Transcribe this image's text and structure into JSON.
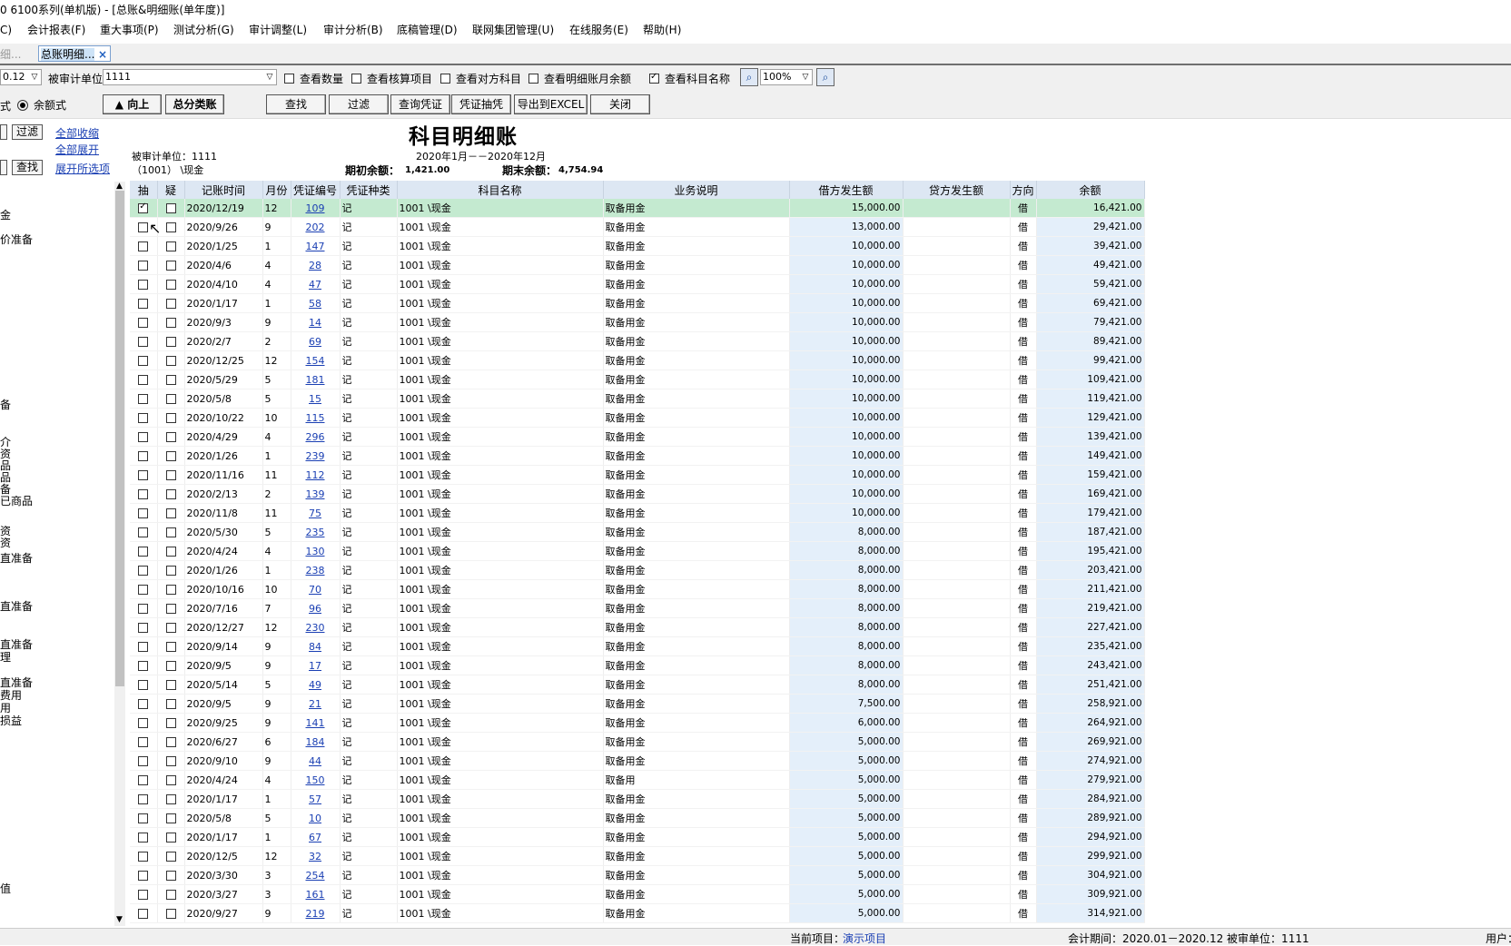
{
  "window": {
    "title": "0 6100系列(单机版) - [总账&明细账(单年度)]"
  },
  "menu": [
    "C)",
    "会计报表(F)",
    "重大事项(P)",
    "测试分析(G)",
    "审计调整(L)",
    "审计分析(B)",
    "底稿管理(D)",
    "联网集团管理(U)",
    "在线服务(E)",
    "帮助(H)"
  ],
  "tabs": {
    "prev_label": "细...",
    "active_label": "总账明细...",
    "close": "×"
  },
  "toolbar": {
    "period_value": "0.12",
    "unit_label": "被审计单位",
    "unit_value": "1111",
    "checkboxes": [
      {
        "label": "查看数量",
        "checked": false
      },
      {
        "label": "查看核算项目",
        "checked": false
      },
      {
        "label": "查看对方科目",
        "checked": false
      },
      {
        "label": "查看明细账月余额",
        "checked": false
      },
      {
        "label": "查看科目名称",
        "checked": true
      }
    ],
    "zoom": "100%",
    "mode_label_prefix": "式",
    "mode_radio_label": "余额式",
    "btn_up": "▲ 向上",
    "btn_general": "总分类账",
    "btn_find": "查找",
    "btn_filter": "过滤",
    "btn_query_voucher": "查询凭证",
    "btn_sample_voucher": "凭证抽凭",
    "btn_export": "导出到EXCEL",
    "btn_close": "关闭"
  },
  "left_panel": {
    "filter_btn": "过滤",
    "find_btn": "查找",
    "collapse_all": "全部收缩",
    "expand_all": "全部展开",
    "expand_options": "展开所选项",
    "tree_fragments": [
      "金",
      "价准备",
      "备",
      "介",
      "资",
      "品",
      "品",
      "备",
      "已商品",
      "资",
      "资",
      "直准备",
      "直准备",
      "直准备",
      "理",
      "直准备",
      "费用",
      "用",
      "损益",
      "值"
    ]
  },
  "report": {
    "title": "科目明细账",
    "period": "2020年1月－－2020年12月",
    "unit_line": "被审计单位：1111",
    "account_line": "（1001）  \\现金",
    "opening_label": "期初余额：",
    "opening_value": "1,421.00",
    "closing_label": "期末余额：",
    "closing_value": "4,754.94"
  },
  "grid": {
    "columns": [
      "抽",
      "疑",
      "记账时间",
      "月份",
      "凭证编号",
      "凭证种类",
      "科目名称",
      "业务说明",
      "借方发生额",
      "贷方发生额",
      "方向",
      "余额"
    ],
    "rows": [
      {
        "chou": true,
        "date": "2020/12/19",
        "month": "12",
        "no": "109",
        "type": "记",
        "account": "1001  \\现金",
        "desc": "取备用金",
        "debit": "15,000.00",
        "credit": "",
        "dir": "借",
        "balance": "16,421.00"
      },
      {
        "chou": false,
        "date": "2020/9/26",
        "month": "9",
        "no": "202",
        "type": "记",
        "account": "1001  \\现金",
        "desc": "取备用金",
        "debit": "13,000.00",
        "credit": "",
        "dir": "借",
        "balance": "29,421.00"
      },
      {
        "chou": false,
        "date": "2020/1/25",
        "month": "1",
        "no": "147",
        "type": "记",
        "account": "1001  \\现金",
        "desc": "取备用金",
        "debit": "10,000.00",
        "credit": "",
        "dir": "借",
        "balance": "39,421.00"
      },
      {
        "chou": false,
        "date": "2020/4/6",
        "month": "4",
        "no": "28",
        "type": "记",
        "account": "1001  \\现金",
        "desc": "取备用金",
        "debit": "10,000.00",
        "credit": "",
        "dir": "借",
        "balance": "49,421.00"
      },
      {
        "chou": false,
        "date": "2020/4/10",
        "month": "4",
        "no": "47",
        "type": "记",
        "account": "1001  \\现金",
        "desc": "取备用金",
        "debit": "10,000.00",
        "credit": "",
        "dir": "借",
        "balance": "59,421.00"
      },
      {
        "chou": false,
        "date": "2020/1/17",
        "month": "1",
        "no": "58",
        "type": "记",
        "account": "1001  \\现金",
        "desc": "取备用金",
        "debit": "10,000.00",
        "credit": "",
        "dir": "借",
        "balance": "69,421.00"
      },
      {
        "chou": false,
        "date": "2020/9/3",
        "month": "9",
        "no": "14",
        "type": "记",
        "account": "1001  \\现金",
        "desc": "取备用金",
        "debit": "10,000.00",
        "credit": "",
        "dir": "借",
        "balance": "79,421.00"
      },
      {
        "chou": false,
        "date": "2020/2/7",
        "month": "2",
        "no": "69",
        "type": "记",
        "account": "1001  \\现金",
        "desc": "取备用金",
        "debit": "10,000.00",
        "credit": "",
        "dir": "借",
        "balance": "89,421.00"
      },
      {
        "chou": false,
        "date": "2020/12/25",
        "month": "12",
        "no": "154",
        "type": "记",
        "account": "1001  \\现金",
        "desc": "取备用金",
        "debit": "10,000.00",
        "credit": "",
        "dir": "借",
        "balance": "99,421.00"
      },
      {
        "chou": false,
        "date": "2020/5/29",
        "month": "5",
        "no": "181",
        "type": "记",
        "account": "1001  \\现金",
        "desc": "取备用金",
        "debit": "10,000.00",
        "credit": "",
        "dir": "借",
        "balance": "109,421.00"
      },
      {
        "chou": false,
        "date": "2020/5/8",
        "month": "5",
        "no": "15",
        "type": "记",
        "account": "1001  \\现金",
        "desc": "取备用金",
        "debit": "10,000.00",
        "credit": "",
        "dir": "借",
        "balance": "119,421.00"
      },
      {
        "chou": false,
        "date": "2020/10/22",
        "month": "10",
        "no": "115",
        "type": "记",
        "account": "1001  \\现金",
        "desc": "取备用金",
        "debit": "10,000.00",
        "credit": "",
        "dir": "借",
        "balance": "129,421.00"
      },
      {
        "chou": false,
        "date": "2020/4/29",
        "month": "4",
        "no": "296",
        "type": "记",
        "account": "1001  \\现金",
        "desc": "取备用金",
        "debit": "10,000.00",
        "credit": "",
        "dir": "借",
        "balance": "139,421.00"
      },
      {
        "chou": false,
        "date": "2020/1/26",
        "month": "1",
        "no": "239",
        "type": "记",
        "account": "1001  \\现金",
        "desc": "取备用金",
        "debit": "10,000.00",
        "credit": "",
        "dir": "借",
        "balance": "149,421.00"
      },
      {
        "chou": false,
        "date": "2020/11/16",
        "month": "11",
        "no": "112",
        "type": "记",
        "account": "1001  \\现金",
        "desc": "取备用金",
        "debit": "10,000.00",
        "credit": "",
        "dir": "借",
        "balance": "159,421.00"
      },
      {
        "chou": false,
        "date": "2020/2/13",
        "month": "2",
        "no": "139",
        "type": "记",
        "account": "1001  \\现金",
        "desc": "取备用金",
        "debit": "10,000.00",
        "credit": "",
        "dir": "借",
        "balance": "169,421.00"
      },
      {
        "chou": false,
        "date": "2020/11/8",
        "month": "11",
        "no": "75",
        "type": "记",
        "account": "1001  \\现金",
        "desc": "取备用金",
        "debit": "10,000.00",
        "credit": "",
        "dir": "借",
        "balance": "179,421.00"
      },
      {
        "chou": false,
        "date": "2020/5/30",
        "month": "5",
        "no": "235",
        "type": "记",
        "account": "1001  \\现金",
        "desc": "取备用金",
        "debit": "8,000.00",
        "credit": "",
        "dir": "借",
        "balance": "187,421.00"
      },
      {
        "chou": false,
        "date": "2020/4/24",
        "month": "4",
        "no": "130",
        "type": "记",
        "account": "1001  \\现金",
        "desc": "取备用金",
        "debit": "8,000.00",
        "credit": "",
        "dir": "借",
        "balance": "195,421.00"
      },
      {
        "chou": false,
        "date": "2020/1/26",
        "month": "1",
        "no": "238",
        "type": "记",
        "account": "1001  \\现金",
        "desc": "取备用金",
        "debit": "8,000.00",
        "credit": "",
        "dir": "借",
        "balance": "203,421.00"
      },
      {
        "chou": false,
        "date": "2020/10/16",
        "month": "10",
        "no": "70",
        "type": "记",
        "account": "1001  \\现金",
        "desc": "取备用金",
        "debit": "8,000.00",
        "credit": "",
        "dir": "借",
        "balance": "211,421.00"
      },
      {
        "chou": false,
        "date": "2020/7/16",
        "month": "7",
        "no": "96",
        "type": "记",
        "account": "1001  \\现金",
        "desc": "取备用金",
        "debit": "8,000.00",
        "credit": "",
        "dir": "借",
        "balance": "219,421.00"
      },
      {
        "chou": false,
        "date": "2020/12/27",
        "month": "12",
        "no": "230",
        "type": "记",
        "account": "1001  \\现金",
        "desc": "取备用金",
        "debit": "8,000.00",
        "credit": "",
        "dir": "借",
        "balance": "227,421.00"
      },
      {
        "chou": false,
        "date": "2020/9/14",
        "month": "9",
        "no": "84",
        "type": "记",
        "account": "1001  \\现金",
        "desc": "取备用金",
        "debit": "8,000.00",
        "credit": "",
        "dir": "借",
        "balance": "235,421.00"
      },
      {
        "chou": false,
        "date": "2020/9/5",
        "month": "9",
        "no": "17",
        "type": "记",
        "account": "1001  \\现金",
        "desc": "取备用金",
        "debit": "8,000.00",
        "credit": "",
        "dir": "借",
        "balance": "243,421.00"
      },
      {
        "chou": false,
        "date": "2020/5/14",
        "month": "5",
        "no": "49",
        "type": "记",
        "account": "1001  \\现金",
        "desc": "取备用金",
        "debit": "8,000.00",
        "credit": "",
        "dir": "借",
        "balance": "251,421.00"
      },
      {
        "chou": false,
        "date": "2020/9/5",
        "month": "9",
        "no": "21",
        "type": "记",
        "account": "1001  \\现金",
        "desc": "取备用金",
        "debit": "7,500.00",
        "credit": "",
        "dir": "借",
        "balance": "258,921.00"
      },
      {
        "chou": false,
        "date": "2020/9/25",
        "month": "9",
        "no": "141",
        "type": "记",
        "account": "1001  \\现金",
        "desc": "取备用金",
        "debit": "6,000.00",
        "credit": "",
        "dir": "借",
        "balance": "264,921.00"
      },
      {
        "chou": false,
        "date": "2020/6/27",
        "month": "6",
        "no": "184",
        "type": "记",
        "account": "1001  \\现金",
        "desc": "取备用金",
        "debit": "5,000.00",
        "credit": "",
        "dir": "借",
        "balance": "269,921.00"
      },
      {
        "chou": false,
        "date": "2020/9/10",
        "month": "9",
        "no": "44",
        "type": "记",
        "account": "1001  \\现金",
        "desc": "取备用金",
        "debit": "5,000.00",
        "credit": "",
        "dir": "借",
        "balance": "274,921.00"
      },
      {
        "chou": false,
        "date": "2020/4/24",
        "month": "4",
        "no": "150",
        "type": "记",
        "account": "1001  \\现金",
        "desc": "取备用",
        "debit": "5,000.00",
        "credit": "",
        "dir": "借",
        "balance": "279,921.00"
      },
      {
        "chou": false,
        "date": "2020/1/17",
        "month": "1",
        "no": "57",
        "type": "记",
        "account": "1001  \\现金",
        "desc": "取备用金",
        "debit": "5,000.00",
        "credit": "",
        "dir": "借",
        "balance": "284,921.00"
      },
      {
        "chou": false,
        "date": "2020/5/8",
        "month": "5",
        "no": "10",
        "type": "记",
        "account": "1001  \\现金",
        "desc": "取备用金",
        "debit": "5,000.00",
        "credit": "",
        "dir": "借",
        "balance": "289,921.00"
      },
      {
        "chou": false,
        "date": "2020/1/17",
        "month": "1",
        "no": "67",
        "type": "记",
        "account": "1001  \\现金",
        "desc": "取备用金",
        "debit": "5,000.00",
        "credit": "",
        "dir": "借",
        "balance": "294,921.00"
      },
      {
        "chou": false,
        "date": "2020/12/5",
        "month": "12",
        "no": "32",
        "type": "记",
        "account": "1001  \\现金",
        "desc": "取备用金",
        "debit": "5,000.00",
        "credit": "",
        "dir": "借",
        "balance": "299,921.00"
      },
      {
        "chou": false,
        "date": "2020/3/30",
        "month": "3",
        "no": "254",
        "type": "记",
        "account": "1001  \\现金",
        "desc": "取备用金",
        "debit": "5,000.00",
        "credit": "",
        "dir": "借",
        "balance": "304,921.00"
      },
      {
        "chou": false,
        "date": "2020/3/27",
        "month": "3",
        "no": "161",
        "type": "记",
        "account": "1001  \\现金",
        "desc": "取备用金",
        "debit": "5,000.00",
        "credit": "",
        "dir": "借",
        "balance": "309,921.00"
      },
      {
        "chou": false,
        "date": "2020/9/27",
        "month": "9",
        "no": "219",
        "type": "记",
        "account": "1001  \\现金",
        "desc": "取备用金",
        "debit": "5,000.00",
        "credit": "",
        "dir": "借",
        "balance": "314,921.00"
      }
    ]
  },
  "status": {
    "current_project_label": "当前项目：",
    "current_project_value": "演示项目",
    "period_text": "会计期间：2020.01－2020.12  被审单位：1111",
    "user_text": "用户："
  },
  "colors": {
    "selected_row": "#c4ead0",
    "amount_column": "#e4effa",
    "header": "#dde7f3",
    "link": "#1a3fb3"
  }
}
